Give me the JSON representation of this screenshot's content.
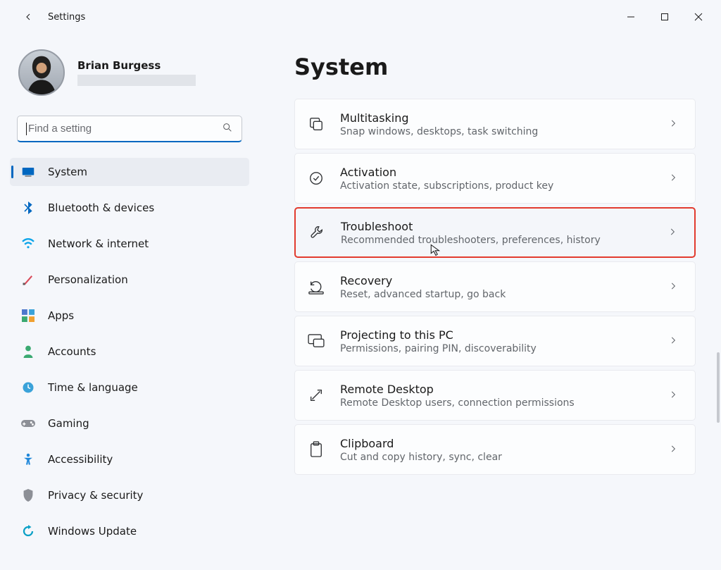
{
  "app": {
    "title": "Settings"
  },
  "user": {
    "name": "Brian Burgess"
  },
  "search": {
    "placeholder": "Find a setting"
  },
  "sidebar": {
    "items": [
      {
        "icon": "system-icon",
        "label": "System",
        "active": true,
        "color": "#0067c0"
      },
      {
        "icon": "bluetooth-icon",
        "label": "Bluetooth & devices",
        "active": false,
        "color": "#0067c0"
      },
      {
        "icon": "wifi-icon",
        "label": "Network & internet",
        "active": false,
        "color": "#0ea5e9"
      },
      {
        "icon": "brush-icon",
        "label": "Personalization",
        "active": false,
        "color": "#d94a59"
      },
      {
        "icon": "apps-icon",
        "label": "Apps",
        "active": false,
        "color": "#4d78cc"
      },
      {
        "icon": "person-icon",
        "label": "Accounts",
        "active": false,
        "color": "#3aa971"
      },
      {
        "icon": "time-icon",
        "label": "Time & language",
        "active": false,
        "color": "#3aa2d9"
      },
      {
        "icon": "gamepad-icon",
        "label": "Gaming",
        "active": false,
        "color": "#8c8f96"
      },
      {
        "icon": "accessibility-icon",
        "label": "Accessibility",
        "active": false,
        "color": "#1d86d9"
      },
      {
        "icon": "shield-icon",
        "label": "Privacy & security",
        "active": false,
        "color": "#8c8f96"
      },
      {
        "icon": "update-icon",
        "label": "Windows Update",
        "active": false,
        "color": "#0aa0c6"
      }
    ]
  },
  "main": {
    "title": "System",
    "cards": [
      {
        "icon": "multitasking-icon",
        "title": "Multitasking",
        "sub": "Snap windows, desktops, task switching",
        "highlighted": false
      },
      {
        "icon": "activation-icon",
        "title": "Activation",
        "sub": "Activation state, subscriptions, product key",
        "highlighted": false
      },
      {
        "icon": "troubleshoot-icon",
        "title": "Troubleshoot",
        "sub": "Recommended troubleshooters, preferences, history",
        "highlighted": true
      },
      {
        "icon": "recovery-icon",
        "title": "Recovery",
        "sub": "Reset, advanced startup, go back",
        "highlighted": false
      },
      {
        "icon": "projecting-icon",
        "title": "Projecting to this PC",
        "sub": "Permissions, pairing PIN, discoverability",
        "highlighted": false
      },
      {
        "icon": "remote-icon",
        "title": "Remote Desktop",
        "sub": "Remote Desktop users, connection permissions",
        "highlighted": false
      },
      {
        "icon": "clipboard-icon",
        "title": "Clipboard",
        "sub": "Cut and copy history, sync, clear",
        "highlighted": false
      }
    ]
  }
}
